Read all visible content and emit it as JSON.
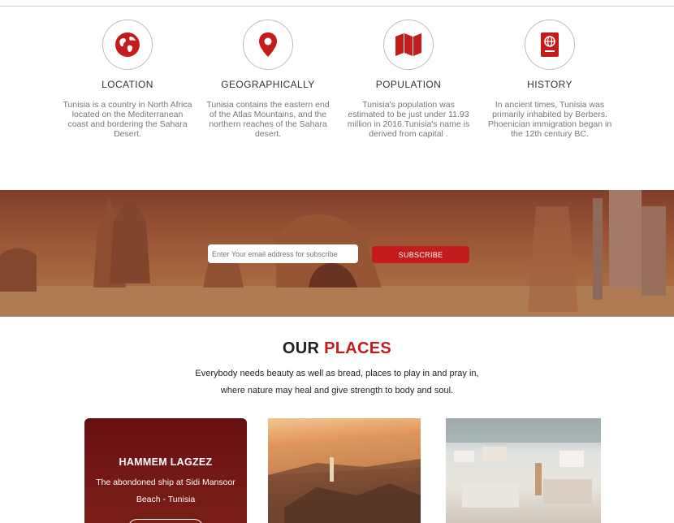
{
  "features": [
    {
      "icon": "globe-icon",
      "title": "LOCATION",
      "desc": "Tunisia is a country in North Africa located on the Mediterranean coast and bordering the Sahara Desert."
    },
    {
      "icon": "map-pin-icon",
      "title": "GEOGRAPHICALLY",
      "desc": "Tunisia contains the eastern end of the Atlas Mountains, and the northern reaches of the Sahara desert."
    },
    {
      "icon": "map-icon",
      "title": "POPULATION",
      "desc": "Tunisia's population was estimated to be just under 11.93 million in 2016.Tunisia's name is derived from capital ."
    },
    {
      "icon": "passport-icon",
      "title": "HISTORY",
      "desc": "In ancient times, Tunisia was primarily inhabited by Berbers. Phoenician immigration began in the 12th century BC."
    }
  ],
  "subscribe": {
    "placeholder": "Enter Your email address for subscribe",
    "button_label": "SUBSCRIBE"
  },
  "places": {
    "title_part1": "OUR ",
    "title_part2": "PLACES",
    "quote_line1": "Everybody needs beauty as well as bread, places to play in and pray in,",
    "quote_line2": "where nature may heal and give strength to body and soul.",
    "cards": [
      {
        "title": "HAMMEM LAGZEZ",
        "text": "The abondoned ship at Sidi Mansoor Beach - Tunisia"
      }
    ]
  },
  "colors": {
    "accent": "#c41c1c",
    "icon_red": "#c41c1c"
  }
}
